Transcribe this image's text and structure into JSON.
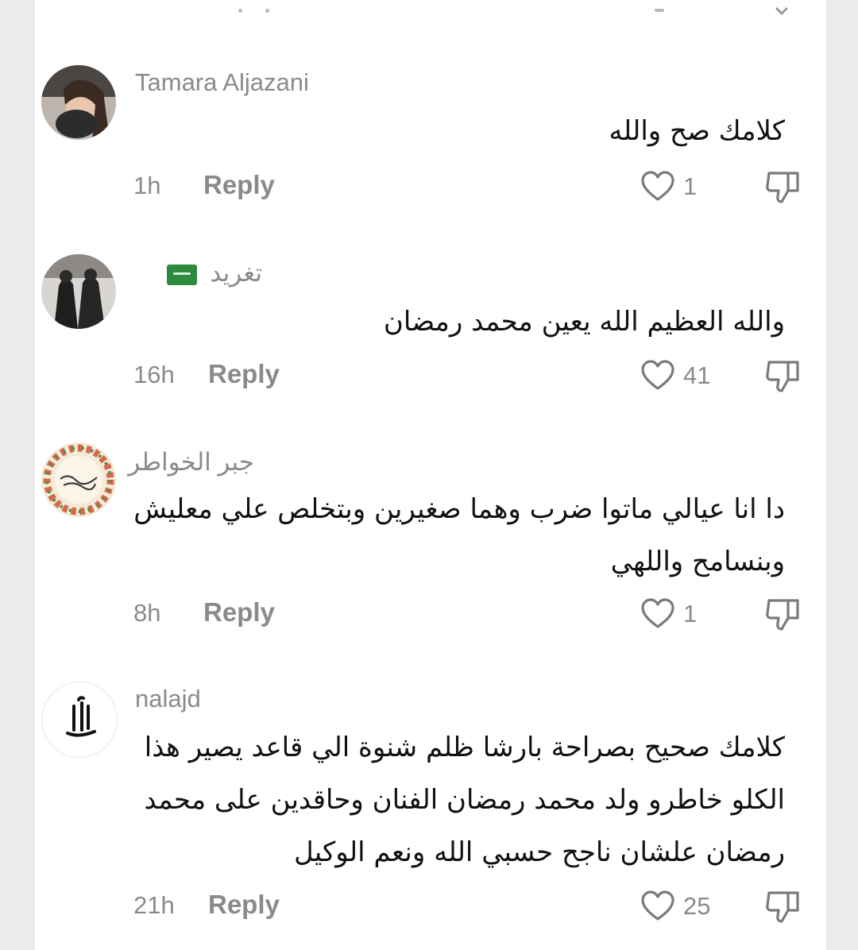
{
  "comments": [
    {
      "author": "Tamara Aljazani",
      "text": "كلامك صح والله",
      "time": "1h",
      "reply_label": "Reply",
      "likes": "1"
    },
    {
      "author": "تغريد",
      "text": "والله العظيم الله يعين محمد رمضان",
      "time": "16h",
      "reply_label": "Reply",
      "likes": "41"
    },
    {
      "author": "جبر الخواطر",
      "text": "دا انا عيالي ماتوا ضرب وهما صغيرين وبتخلص علي معليش وبنسامح واللهي",
      "time": "8h",
      "reply_label": "Reply",
      "likes": "1"
    },
    {
      "author": "nalajd",
      "text": "كلامك صحيح بصراحة بارشا ظلم شنوة الي قاعد يصير هذا الكلو خاطرو ولد محمد رمضان الفنان وحاقدين على محمد رمضان علشان ناجح حسبي الله ونعم الوكيل",
      "time": "21h",
      "reply_label": "Reply",
      "likes": "25"
    }
  ],
  "icons": {
    "like": "heart-outline-icon",
    "dislike": "thumbs-down-outline-icon",
    "flag": "saudi-flag-emoji"
  },
  "colors": {
    "meta_text": "#8a8a8a",
    "body_text": "#111111",
    "background": "#ffffff"
  }
}
